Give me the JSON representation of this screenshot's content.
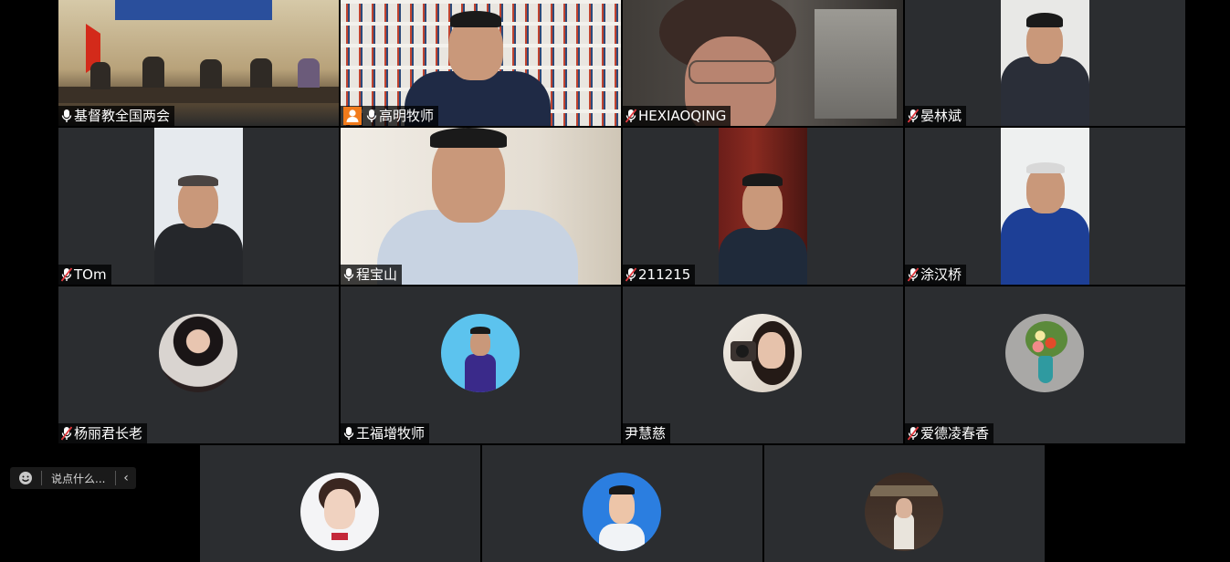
{
  "participants": [
    {
      "name": "基督教全国两会",
      "mic": "on",
      "kind": "video"
    },
    {
      "name": "高明牧师",
      "mic": "on",
      "kind": "video",
      "host": true
    },
    {
      "name": "HEXIAOQING",
      "mic": "muted",
      "kind": "video"
    },
    {
      "name": "晏林斌",
      "mic": "muted",
      "kind": "video"
    },
    {
      "name": "TOm",
      "mic": "muted",
      "kind": "video"
    },
    {
      "name": "程宝山",
      "mic": "on",
      "kind": "video"
    },
    {
      "name": "211215",
      "mic": "muted",
      "kind": "video"
    },
    {
      "name": "涂汉桥",
      "mic": "muted",
      "kind": "video"
    },
    {
      "name": "杨丽君长老",
      "mic": "muted",
      "kind": "avatar"
    },
    {
      "name": "王福增牧师",
      "mic": "on",
      "kind": "avatar"
    },
    {
      "name": "尹慧慈",
      "mic": "none",
      "kind": "avatar"
    },
    {
      "name": "爱德凌春香",
      "mic": "muted",
      "kind": "avatar"
    },
    {
      "name": "",
      "mic": "none",
      "kind": "avatar"
    },
    {
      "name": "",
      "mic": "none",
      "kind": "avatar"
    },
    {
      "name": "",
      "mic": "none",
      "kind": "avatar"
    }
  ],
  "chat": {
    "placeholder": "说点什么...",
    "emoji_icon": "emoji-icon",
    "collapse_icon": "chevron-left-icon"
  },
  "colors": {
    "tile_bg": "#2b2d30",
    "host_badge": "#f27b1b",
    "muted_red": "#e0393e",
    "label_bg": "#000000"
  }
}
